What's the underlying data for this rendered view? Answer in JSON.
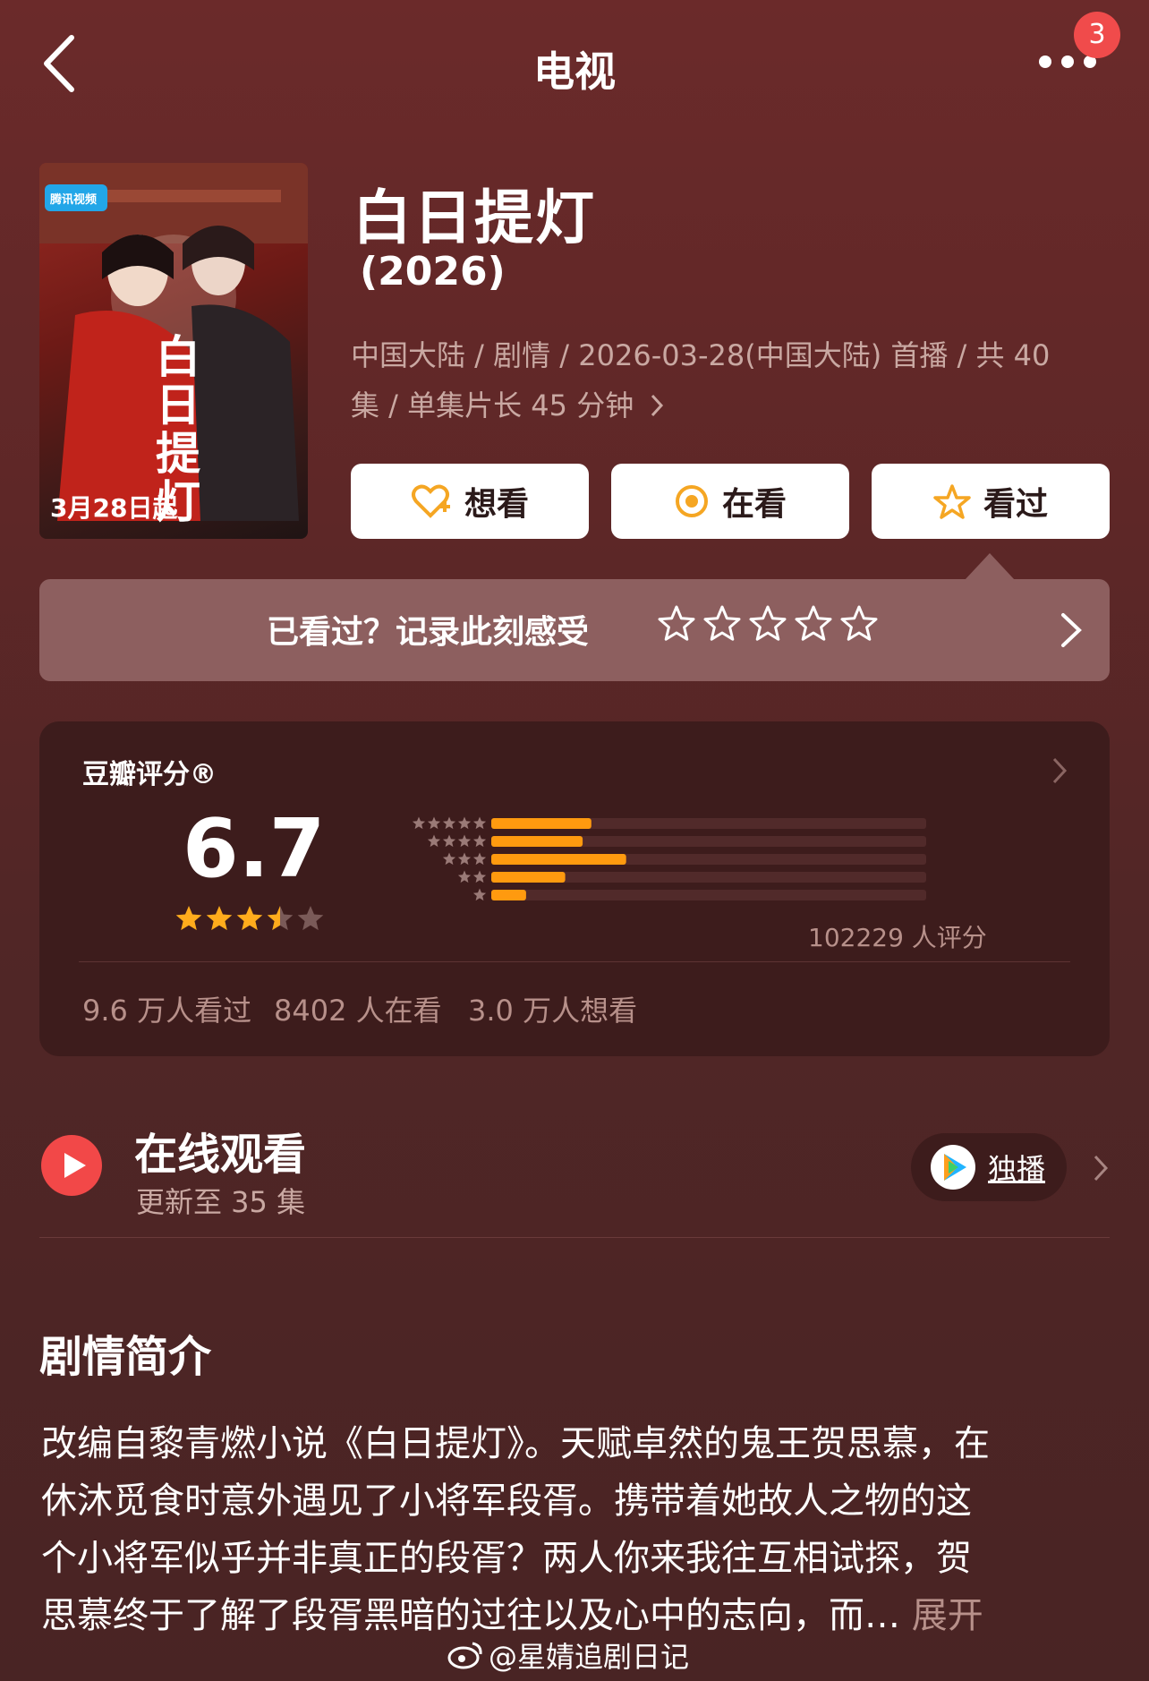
{
  "nav": {
    "title": "电视",
    "notification_count": "3",
    "back_icon": "chevron-left-icon",
    "more_icon": "more-dots-icon"
  },
  "poster": {
    "platform_badge": "腾讯视频",
    "vertical_title": "白日提灯",
    "release_text": "3月28日起"
  },
  "show": {
    "title": "白日提灯",
    "year": "(2026)",
    "meta_line1": "中国大陆 / 剧情 / 2026-03-28(中国大陆) 首播 / 共 40",
    "meta_line2": "集 / 单集片长 45 分钟"
  },
  "actions": {
    "want": "想看",
    "watching": "在看",
    "watched": "看过"
  },
  "record": {
    "prompt": "已看过？记录此刻感受"
  },
  "rating": {
    "label": "豆瓣评分®",
    "score": "6.7",
    "score_stars": 3.5,
    "count_text": "102229 人评分",
    "distribution": [
      {
        "stars": 5,
        "fraction": 0.23
      },
      {
        "stars": 4,
        "fraction": 0.21
      },
      {
        "stars": 3,
        "fraction": 0.31
      },
      {
        "stars": 2,
        "fraction": 0.17
      },
      {
        "stars": 1,
        "fraction": 0.08
      }
    ],
    "stats": [
      "9.6 万人看过",
      "8402 人在看",
      "3.0 万人想看"
    ],
    "bar_color": "#ff9a0f"
  },
  "watch": {
    "title": "在线观看",
    "subtitle": "更新至 35 集",
    "exclusive": "独播"
  },
  "synopsis": {
    "heading": "剧情简介",
    "lines": [
      "改编自黎青燃小说《白日提灯》。天赋卓然的鬼王贺思慕，在",
      "休沐觅食时意外遇见了小将军段胥。携带着她故人之物的这",
      "个小将军似乎并非真正的段胥？两人你来我往互相试探，贺",
      "思慕终于了解了段胥黑暗的过往以及心中的志向，而…"
    ],
    "expand": "展开"
  },
  "watermark": "@星婧追剧日记"
}
